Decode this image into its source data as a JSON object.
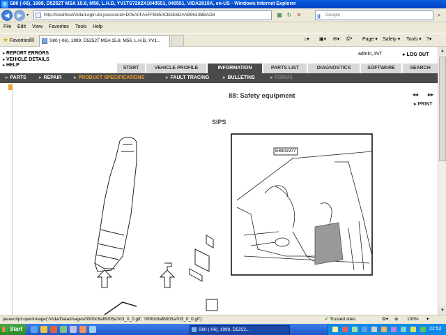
{
  "window": {
    "title": "S80 (-06), 1999, D5252T MSA 15.8, M56, L.H.D, YV1TS7202X1040551, 040551, VIDA2010A, en-US - Windows Internet Explorer"
  },
  "address_bar": {
    "url": "http://localhost/Vida/Login.do;jsessionid=D05A0FA5FFB850CB3E6D4AB9633BBAD8",
    "search_placeholder": "Google"
  },
  "menu": [
    "File",
    "Edit",
    "View",
    "Favorites",
    "Tools",
    "Help"
  ],
  "favorites_bar": {
    "favorites_label": "Favorites",
    "tab_title": "S80 (-06), 1999, D5252T MSA 15.8, M56, L.H.D, YV1...",
    "commands": [
      "Page ▾",
      "Safety ▾",
      "Tools ▾",
      "?▾"
    ]
  },
  "app": {
    "top_links": [
      "REPORT ERRORS",
      "VEHICLE DETAILS",
      "HELP"
    ],
    "user": "admin, INT",
    "logout": "LOG OUT",
    "nav_tabs": [
      {
        "label": "START",
        "active": false
      },
      {
        "label": "VEHICLE PROFILE",
        "active": false
      },
      {
        "label": "INFORMATION",
        "active": true
      },
      {
        "label": "PARTS LIST",
        "active": false
      },
      {
        "label": "DIAGNOSTICS",
        "active": false
      },
      {
        "label": "SOFTWARE",
        "active": false
      },
      {
        "label": "SEARCH",
        "active": false
      }
    ],
    "sub_nav": [
      {
        "label": "PARTS",
        "state": "normal"
      },
      {
        "label": "REPAIR",
        "state": "normal"
      },
      {
        "label": "PRODUCT SPECIFICATIONS",
        "state": "active"
      },
      {
        "label": "FAULT TRACING",
        "state": "normal"
      },
      {
        "label": "BULLETINS",
        "state": "normal"
      },
      {
        "label": "FORMS",
        "state": "disabled"
      }
    ],
    "section_title": "88: Safety equipment",
    "prev_icon": "◂◂",
    "next_icon": "▸▸",
    "print_label": "PRINT",
    "figure_label": "SIPS",
    "figure_code": "E8801977"
  },
  "status_bar": {
    "text": "javascript:openImage('/Vida/DataImages/0900c8af8005a7d3_0_0.gif', '0900c8af8005a7d3_0_0.gif')",
    "zone": "Trusted sites",
    "zoom": "100%"
  },
  "taskbar": {
    "start_label": "Start",
    "task_item": "S80 (-06), 1999, D5252...",
    "clock": "22:52"
  },
  "colors": {
    "accent": "#f0a030",
    "nav_dark": "#4a4a4a",
    "tab_light": "#d8d8d8"
  }
}
